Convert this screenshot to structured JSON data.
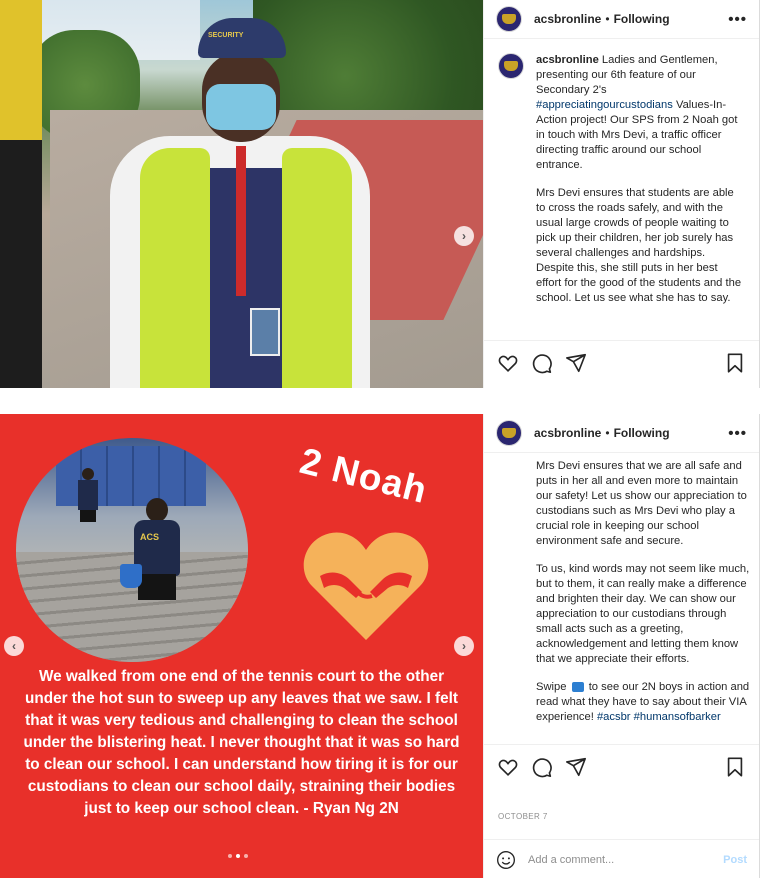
{
  "post1": {
    "header": {
      "username": "acsbronline",
      "separator": "•",
      "follow_label": "Following",
      "more": "•••"
    },
    "photo": {
      "cap_text": "SECURITY"
    },
    "caption": {
      "username": "acsbronline",
      "text_a": " Ladies and Gentlemen, presenting our 6th feature of our Secondary 2's ",
      "hashtag": "#appreciatingourcustodians",
      "text_b": " Values-In-Action project! Our SPS from 2 Noah got in touch with Mrs Devi, a traffic officer directing traffic around our school entrance.",
      "para2": "Mrs Devi ensures that students are able to cross the roads safely, and with the usual large crowds of people waiting to pick up their children, her job surely has several challenges and hardships. Despite this, she still puts in her best effort for the good of the students and the school. Let us see what she has to say."
    },
    "next_arrow": "›"
  },
  "post2": {
    "header": {
      "username": "acsbronline",
      "separator": "•",
      "follow_label": "Following",
      "more": "•••"
    },
    "image": {
      "title": "2 Noah",
      "shirt_text": "ACS",
      "quote": "We walked from one end of the tennis court to the other under the hot sun to sweep up any leaves that we saw. I felt that it was very tedious and challenging to clean the school under the blistering heat. I never thought that it was so hard to clean our school. I can understand how tiring it is for our custodians to clean our school daily, straining their bodies just to keep our school clean. - Ryan Ng 2N",
      "prev_arrow": "‹",
      "next_arrow": "›",
      "pager": {
        "count": 3,
        "active": 2
      }
    },
    "caption": {
      "para1": "Mrs Devi ensures that we are all safe and puts in her all and even more to maintain our safety! Let us show our appreciation to custodians such as Mrs Devi who play a crucial role in keeping our school environment safe and secure.",
      "para2": "To us, kind words may not seem like much, but to them, it can really make a difference and brighten their day. We can show our appreciation to our custodians through small acts such as a greeting, acknowledgement and letting them know that we appreciate their efforts.",
      "swipe_a": "Swipe",
      "swipe_b": " to see our 2N boys in action and read what they have to say about their VIA experience! ",
      "tag1": "#acsbr",
      "tag2": "#humansofbarker"
    },
    "timestamp": "OCTOBER 7",
    "comment": {
      "placeholder": "Add a comment...",
      "post_label": "Post"
    }
  },
  "colors": {
    "red_bg": "#e8302a",
    "heart": "#f5b25a",
    "hashtag": "#00376b",
    "post_button": "#b3dbff"
  },
  "icons": [
    "heart-icon",
    "comment-icon",
    "share-icon",
    "bookmark-icon",
    "smile-icon",
    "more-icon"
  ]
}
